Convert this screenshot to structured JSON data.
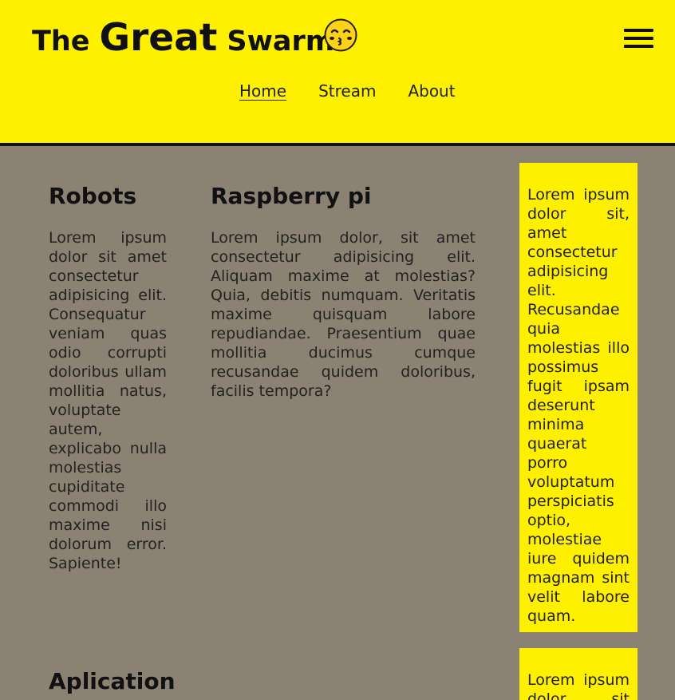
{
  "header": {
    "logo": {
      "word1": "The",
      "word2": "Great",
      "word3": "Swarm",
      "face_icon": "kissing-face-emoji"
    },
    "menu_icon": "hamburger-menu-icon",
    "nav": {
      "home": "Home",
      "stream": "Stream",
      "about": "About",
      "active": "Home"
    }
  },
  "colors": {
    "header_bg": "#fff000",
    "page_bg": "#8b8274",
    "aside_bg": "#fff000",
    "text": "#111111"
  },
  "main": {
    "robots": {
      "title": "Robots",
      "text": "Lorem ipsum dolor sit amet consectetur adipisicing elit. Consequatur veniam quas odio corrupti doloribus ullam mollitia natus, voluptate autem, explicabo nulla molestias cupiditate commodi illo maxime nisi dolorum error. Sapiente!"
    },
    "raspberry": {
      "title": "Raspberry pi",
      "text": "Lorem ipsum dolor, sit amet consectetur adipisicing elit. Aliquam maxime at molestias? Quia, debitis numquam. Veritatis maxime quisquam labore repudiandae. Praesentium quae mollitia ducimus cumque recusandae quidem doloribus, facilis tempora?"
    },
    "aplication": {
      "title": "Aplication"
    }
  },
  "aside": {
    "box1": "Lorem ipsum dolor sit, amet consectetur adipisicing elit. Recusandae quia molestias illo possimus fugit ipsam deserunt minima quaerat porro voluptatum perspiciatis optio, molestiae iure quidem magnam sint velit labore quam.",
    "box2": "Lorem ipsum dolor sit amet"
  }
}
